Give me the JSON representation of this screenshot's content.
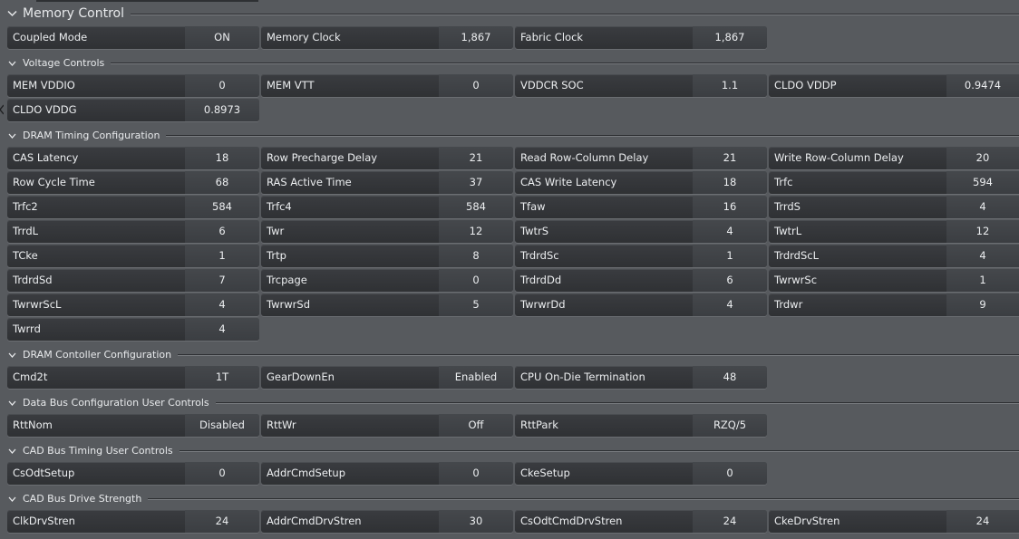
{
  "sections": {
    "memory_control": {
      "title": "Memory Control",
      "rows": [
        [
          {
            "label": "Coupled Mode",
            "value": "ON"
          },
          {
            "label": "Memory Clock",
            "value": "1,867"
          },
          {
            "label": "Fabric Clock",
            "value": "1,867"
          }
        ]
      ]
    },
    "voltage_controls": {
      "title": "Voltage Controls",
      "rows": [
        [
          {
            "label": "MEM VDDIO",
            "value": "0"
          },
          {
            "label": "MEM VTT",
            "value": "0"
          },
          {
            "label": "VDDCR SOC",
            "value": "1.1"
          },
          {
            "label": "CLDO VDDP",
            "value": "0.9474"
          }
        ],
        [
          {
            "label": "CLDO VDDG",
            "value": "0.8973"
          }
        ]
      ]
    },
    "dram_timing": {
      "title": "DRAM Timing Configuration",
      "rows": [
        [
          {
            "label": "CAS Latency",
            "value": "18"
          },
          {
            "label": "Row Precharge Delay",
            "value": "21"
          },
          {
            "label": "Read Row-Column Delay",
            "value": "21"
          },
          {
            "label": "Write Row-Column Delay",
            "value": "20"
          }
        ],
        [
          {
            "label": "Row Cycle Time",
            "value": "68"
          },
          {
            "label": "RAS Active Time",
            "value": "37"
          },
          {
            "label": "CAS Write Latency",
            "value": "18"
          },
          {
            "label": "Trfc",
            "value": "594"
          }
        ],
        [
          {
            "label": "Trfc2",
            "value": "584"
          },
          {
            "label": "Trfc4",
            "value": "584"
          },
          {
            "label": "Tfaw",
            "value": "16"
          },
          {
            "label": "TrrdS",
            "value": "4"
          }
        ],
        [
          {
            "label": "TrrdL",
            "value": "6"
          },
          {
            "label": "Twr",
            "value": "12"
          },
          {
            "label": "TwtrS",
            "value": "4"
          },
          {
            "label": "TwtrL",
            "value": "12"
          }
        ],
        [
          {
            "label": "TCke",
            "value": "1"
          },
          {
            "label": "Trtp",
            "value": "8"
          },
          {
            "label": "TrdrdSc",
            "value": "1"
          },
          {
            "label": "TrdrdScL",
            "value": "4"
          }
        ],
        [
          {
            "label": "TrdrdSd",
            "value": "7"
          },
          {
            "label": "Trcpage",
            "value": "0"
          },
          {
            "label": "TrdrdDd",
            "value": "6"
          },
          {
            "label": "TwrwrSc",
            "value": "1"
          }
        ],
        [
          {
            "label": "TwrwrScL",
            "value": "4"
          },
          {
            "label": "TwrwrSd",
            "value": "5"
          },
          {
            "label": "TwrwrDd",
            "value": "4"
          },
          {
            "label": "Trdwr",
            "value": "9"
          }
        ],
        [
          {
            "label": "Twrrd",
            "value": "4"
          }
        ]
      ]
    },
    "dram_controller": {
      "title": "DRAM Contoller Configuration",
      "rows": [
        [
          {
            "label": "Cmd2t",
            "value": "1T"
          },
          {
            "label": "GearDownEn",
            "value": "Enabled"
          },
          {
            "label": "CPU On-Die Termination",
            "value": "48"
          }
        ]
      ]
    },
    "data_bus": {
      "title": "Data Bus Configuration User Controls",
      "rows": [
        [
          {
            "label": "RttNom",
            "value": "Disabled"
          },
          {
            "label": "RttWr",
            "value": "Off"
          },
          {
            "label": "RttPark",
            "value": "RZQ/5"
          }
        ]
      ]
    },
    "cad_bus_timing": {
      "title": "CAD Bus Timing User Controls",
      "rows": [
        [
          {
            "label": "CsOdtSetup",
            "value": "0"
          },
          {
            "label": "AddrCmdSetup",
            "value": "0"
          },
          {
            "label": "CkeSetup",
            "value": "0"
          }
        ]
      ]
    },
    "cad_bus_drive": {
      "title": "CAD Bus Drive Strength",
      "rows": [
        [
          {
            "label": "ClkDrvStren",
            "value": "24"
          },
          {
            "label": "AddrCmdDrvStren",
            "value": "30"
          },
          {
            "label": "CsOdtCmdDrvStren",
            "value": "24"
          },
          {
            "label": "CkeDrvStren",
            "value": "24"
          }
        ]
      ]
    }
  }
}
